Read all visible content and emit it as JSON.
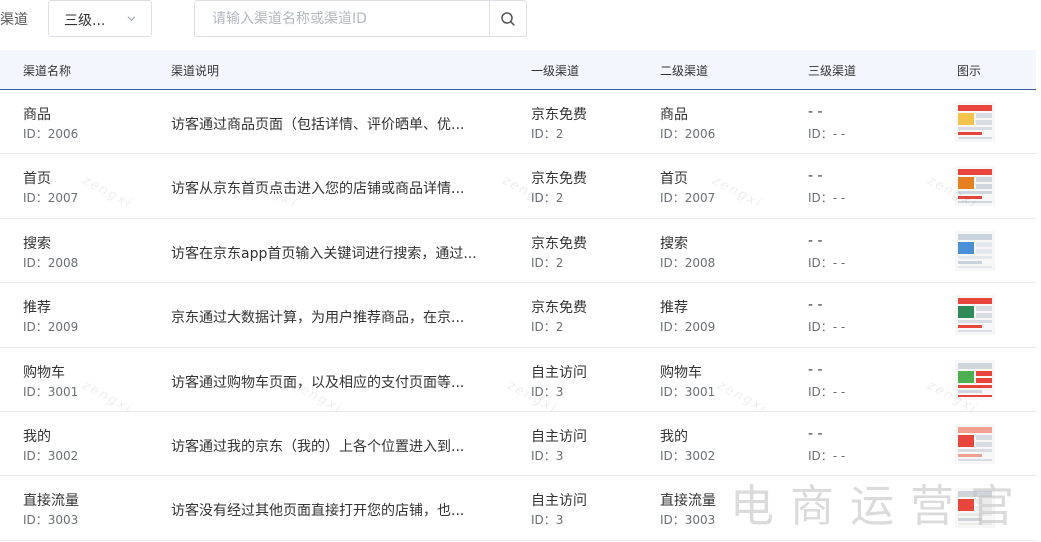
{
  "filter": {
    "label": "渠道",
    "level_value": "三级...",
    "search_placeholder": "请输入渠道名称或渠道ID"
  },
  "table": {
    "headers": [
      "渠道名称",
      "渠道说明",
      "一级渠道",
      "二级渠道",
      "三级渠道",
      "图示"
    ],
    "rows": [
      {
        "name": "商品",
        "id": "ID：2006",
        "desc": "访客通过商品页面（包括详情、评价晒单、优...",
        "l1": "京东免费",
        "l1_id": "ID：2",
        "l2": "商品",
        "l2_id": "ID：2006",
        "l3": "- -",
        "l3_id": "ID：- -"
      },
      {
        "name": "首页",
        "id": "ID：2007",
        "desc": "访客从京东首页点击进入您的店铺或商品详情...",
        "l1": "京东免费",
        "l1_id": "ID：2",
        "l2": "首页",
        "l2_id": "ID：2007",
        "l3": "- -",
        "l3_id": "ID：- -"
      },
      {
        "name": "搜索",
        "id": "ID：2008",
        "desc": "访客在京东app首页输入关键词进行搜索，通过...",
        "l1": "京东免费",
        "l1_id": "ID：2",
        "l2": "搜索",
        "l2_id": "ID：2008",
        "l3": "- -",
        "l3_id": "ID：- -"
      },
      {
        "name": "推荐",
        "id": "ID：2009",
        "desc": "京东通过大数据计算，为用户推荐商品，在京...",
        "l1": "京东免费",
        "l1_id": "ID：2",
        "l2": "推荐",
        "l2_id": "ID：2009",
        "l3": "- -",
        "l3_id": "ID：- -"
      },
      {
        "name": "购物车",
        "id": "ID：3001",
        "desc": "访客通过购物车页面，以及相应的支付页面等...",
        "l1": "自主访问",
        "l1_id": "ID：3",
        "l2": "购物车",
        "l2_id": "ID：3001",
        "l3": "- -",
        "l3_id": "ID：- -"
      },
      {
        "name": "我的",
        "id": "ID：3002",
        "desc": "访客通过我的京东（我的）上各个位置进入到...",
        "l1": "自主访问",
        "l1_id": "ID：3",
        "l2": "我的",
        "l2_id": "ID：3002",
        "l3": "- -",
        "l3_id": "ID：- -"
      },
      {
        "name": "直接流量",
        "id": "ID：3003",
        "desc": "访客没有经过其他页面直接打开您的店铺，也...",
        "l1": "自主访问",
        "l1_id": "ID：3",
        "l2": "直接流量",
        "l2_id": "ID：3003",
        "l3": "",
        "l3_id": ""
      }
    ]
  },
  "watermarks": {
    "repeat_text": "zengxi",
    "brand": "电商运营官"
  },
  "colors": {
    "header_bg": "#f3f6fc",
    "header_border": "#3b5a94",
    "row_border": "#e8eaee",
    "muted": "#6b6f76"
  }
}
